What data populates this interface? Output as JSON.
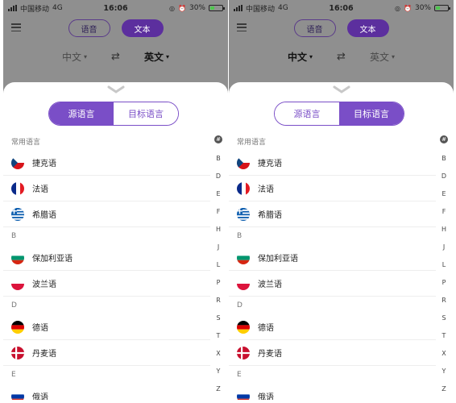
{
  "status": {
    "carrier": "中国移动",
    "network": "4G",
    "time": "16:06",
    "battery": "30%"
  },
  "modes": {
    "voice": "语音",
    "text": "文本"
  },
  "lang_selector": {
    "source": "中文",
    "target": "英文",
    "swap_icon": "swap-arrows-icon"
  },
  "tabs": {
    "source": "源语言",
    "target": "目标语言"
  },
  "sections": {
    "common": "常用语言",
    "b": "B",
    "d": "D",
    "e": "E"
  },
  "languages": {
    "czech": "捷克语",
    "french": "法语",
    "greek": "希腊语",
    "bulgarian": "保加利亚语",
    "polish": "波兰语",
    "german": "德语",
    "danish": "丹麦语",
    "russian": "俄语"
  },
  "index": {
    "hash": "#",
    "letters": [
      "B",
      "D",
      "E",
      "F",
      "H",
      "J",
      "L",
      "P",
      "R",
      "S",
      "T",
      "X",
      "Y",
      "Z"
    ]
  },
  "colors": {
    "accent": "#7a4ec7",
    "dark_accent": "#5c2f9e",
    "overlay": "#8f8f8f"
  }
}
